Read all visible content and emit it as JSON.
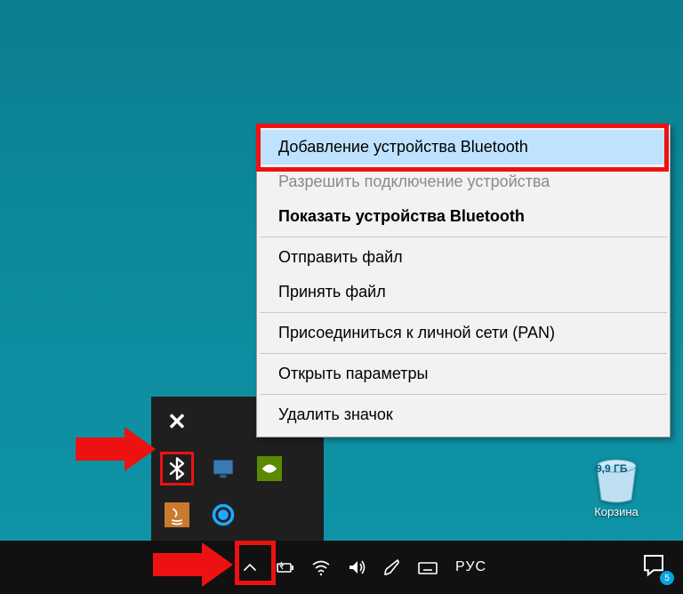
{
  "menu": {
    "items": [
      {
        "label": "Добавление устройства Bluetooth",
        "state": "selected"
      },
      {
        "label": "Разрешить подключение устройства",
        "state": "disabled"
      },
      {
        "label": "Показать устройства Bluetooth",
        "state": "bold"
      },
      {
        "sep": true
      },
      {
        "label": "Отправить файл",
        "state": ""
      },
      {
        "label": "Принять файл",
        "state": ""
      },
      {
        "sep": true
      },
      {
        "label": "Присоединиться к личной сети (PAN)",
        "state": ""
      },
      {
        "sep": true
      },
      {
        "label": "Открыть параметры",
        "state": ""
      },
      {
        "sep": true
      },
      {
        "label": "Удалить значок",
        "state": ""
      }
    ]
  },
  "recycle_bin": {
    "label": "Корзина",
    "capacity": "9,9 ГБ"
  },
  "taskbar": {
    "language": "РУС",
    "notif_count": "5"
  },
  "overflow_icons": [
    "security-icon",
    "bluetooth-icon",
    "monitor-icon",
    "nvidia-icon",
    "java-icon",
    "cortana-icon"
  ]
}
